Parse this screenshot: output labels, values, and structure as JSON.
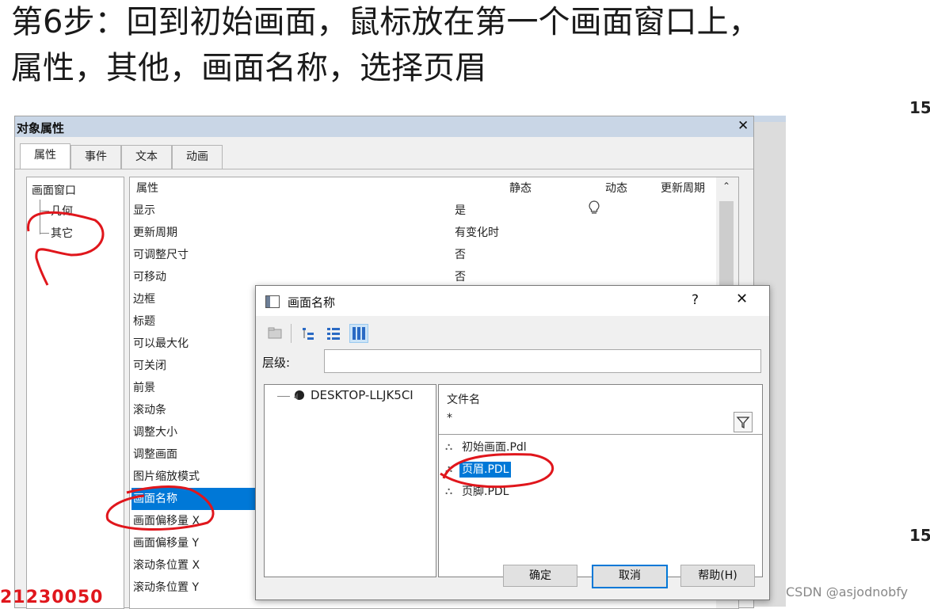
{
  "slide": {
    "line1": "第6步：回到初始画面，鼠标放在第一个画面窗口上，",
    "line2": "属性，其他，画面名称，选择页眉",
    "right_num_top": "15",
    "right_num_bottom": "15",
    "bottom_num": "21230050",
    "watermark": "CSDN @asjodnobfy"
  },
  "objwin": {
    "title": "对象属性",
    "close": "✕",
    "tabs": [
      "属性",
      "事件",
      "文本",
      "动画"
    ],
    "tree": {
      "root": "画面窗口",
      "child1": "几何",
      "child2": "其它"
    },
    "columns": {
      "prop": "属性",
      "static": "静态",
      "dynamic": "动态",
      "update": "更新周期"
    },
    "rows": [
      {
        "name": "显示",
        "value": "是"
      },
      {
        "name": "更新周期",
        "value": "有变化时"
      },
      {
        "name": "可调整尺寸",
        "value": "否"
      },
      {
        "name": "可移动",
        "value": "否"
      },
      {
        "name": "边框",
        "value": ""
      },
      {
        "name": "标题",
        "value": ""
      },
      {
        "name": "可以最大化",
        "value": ""
      },
      {
        "name": "可关闭",
        "value": ""
      },
      {
        "name": "前景",
        "value": ""
      },
      {
        "name": "滚动条",
        "value": ""
      },
      {
        "name": "调整大小",
        "value": ""
      },
      {
        "name": "调整画面",
        "value": ""
      },
      {
        "name": "图片缩放模式",
        "value": ""
      },
      {
        "name": "画面名称",
        "value": ""
      },
      {
        "name": "画面偏移量  X",
        "value": ""
      },
      {
        "name": "画面偏移量  Y",
        "value": ""
      },
      {
        "name": "滚动条位置 X",
        "value": ""
      },
      {
        "name": "滚动条位置 Y",
        "value": ""
      }
    ]
  },
  "dialog": {
    "title": "画面名称",
    "help": "?",
    "close": "✕",
    "level_label": "层级:",
    "level_value": "",
    "computer": "DESKTOP-LLJK5CI",
    "filename_header": "文件名",
    "filter_value": "*",
    "files": [
      "初始画面.Pdl",
      "页眉.PDL",
      "页脚.PDL"
    ],
    "ok": "确定",
    "cancel": "取消",
    "help_btn": "帮助(H)"
  },
  "colors": {
    "selection": "#0078d7",
    "annotation": "#e0161c",
    "title_bar": "#c9d6e6"
  }
}
